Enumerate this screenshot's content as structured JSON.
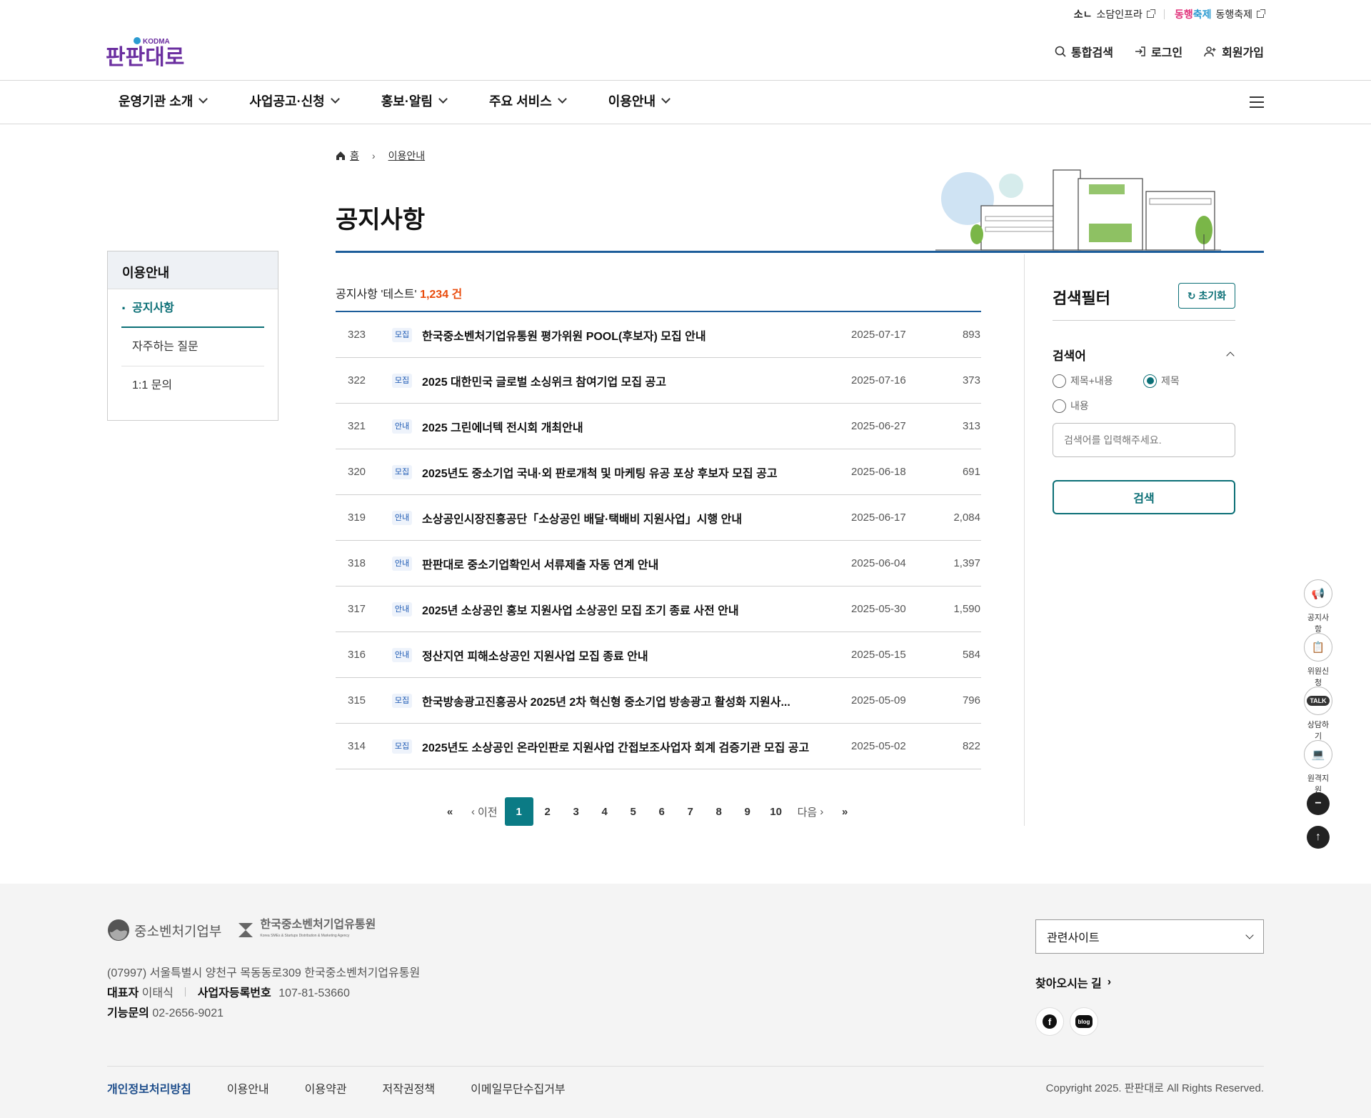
{
  "top_util": {
    "sodam": "소담인프라",
    "dong_logo": "동행축제",
    "dong": "동행축제"
  },
  "header": {
    "brand": "판판대로",
    "brand_sub": "KODMA",
    "search": "통합검색",
    "login": "로그인",
    "join": "회원가입"
  },
  "gnb": [
    "운영기관 소개",
    "사업공고·신청",
    "홍보·알림",
    "주요 서비스",
    "이용안내"
  ],
  "breadcrumb": {
    "home": "홈",
    "current": "이용안내"
  },
  "page_title": "공지사항",
  "side": {
    "title": "이용안내",
    "items": [
      "공지사항",
      "자주하는 질문",
      "1:1 문의"
    ]
  },
  "count": {
    "prefix": "공지사항 '테스트'",
    "value": "1,234 건"
  },
  "rows": [
    {
      "num": "323",
      "badge": "모집",
      "title": "한국중소벤처기업유통원 평가위원 POOL(후보자) 모집 안내",
      "date": "2025-07-17",
      "views": "893"
    },
    {
      "num": "322",
      "badge": "모집",
      "title": "2025 대한민국 글로벌 소싱위크 참여기업 모집 공고",
      "date": "2025-07-16",
      "views": "373"
    },
    {
      "num": "321",
      "badge": "안내",
      "title": "2025 그린에너텍 전시회 개최안내",
      "date": "2025-06-27",
      "views": "313"
    },
    {
      "num": "320",
      "badge": "모집",
      "title": "2025년도 중소기업 국내·외 판로개척 및 마케팅 유공 포상 후보자 모집 공고",
      "date": "2025-06-18",
      "views": "691"
    },
    {
      "num": "319",
      "badge": "안내",
      "title": "소상공인시장진흥공단「소상공인 배달·택배비 지원사업」시행 안내",
      "date": "2025-06-17",
      "views": "2,084"
    },
    {
      "num": "318",
      "badge": "안내",
      "title": "판판대로 중소기업확인서 서류제출 자동 연계 안내",
      "date": "2025-06-04",
      "views": "1,397"
    },
    {
      "num": "317",
      "badge": "안내",
      "title": "2025년 소상공인 홍보 지원사업 소상공인 모집 조기 종료 사전 안내",
      "date": "2025-05-30",
      "views": "1,590"
    },
    {
      "num": "316",
      "badge": "안내",
      "title": "정산지연 피해소상공인 지원사업 모집 종료 안내",
      "date": "2025-05-15",
      "views": "584"
    },
    {
      "num": "315",
      "badge": "모집",
      "title": "한국방송광고진흥공사 2025년 2차 혁신형 중소기업 방송광고 활성화 지원사...",
      "date": "2025-05-09",
      "views": "796"
    },
    {
      "num": "314",
      "badge": "모집",
      "title": "2025년도 소상공인 온라인판로 지원사업 간접보조사업자 회계 검증기관 모집 공고",
      "date": "2025-05-02",
      "views": "822"
    }
  ],
  "filter": {
    "title": "검색필터",
    "reset": "초기화",
    "keyword": "검색어",
    "opt1": "제목+내용",
    "opt2": "제목",
    "opt3": "내용",
    "placeholder": "검색어를 입력해주세요.",
    "search": "검색"
  },
  "pagination": {
    "prev": "이전",
    "next": "다음",
    "pages": [
      "1",
      "2",
      "3",
      "4",
      "5",
      "6",
      "7",
      "8",
      "9",
      "10"
    ],
    "current": "1"
  },
  "quick": {
    "q1": "공지사항",
    "q2": "위원신청",
    "q3": "상담하기",
    "q4": "원격지원"
  },
  "footer": {
    "org1": "중소벤처기업부",
    "org2": "한국중소벤처기업유통원",
    "org2_en": "Korea SMEs & Startups Distribution & Marketing Agency",
    "address": "(07997) 서울특별시 양천구 목동동로309 한국중소벤처기업유통원",
    "ceo_label": "대표자",
    "ceo": "이태식",
    "biz_label": "사업자등록번호",
    "biz": "107-81-53660",
    "tel_label": "기능문의",
    "tel": "02-2656-9021",
    "related": "관련사이트",
    "directions": "찾아오시는 길",
    "blog": "blog",
    "links": [
      "개인정보처리방침",
      "이용안내",
      "이용약관",
      "저작권정책",
      "이메일무단수집거부"
    ],
    "copyright": "Copyright 2025. 판판대로 All Rights Reserved."
  },
  "colors": {
    "primary": "#0b6f76",
    "accent": "#e94b0c",
    "navy": "#1d5d9a",
    "brand": "#6b2fa0"
  }
}
